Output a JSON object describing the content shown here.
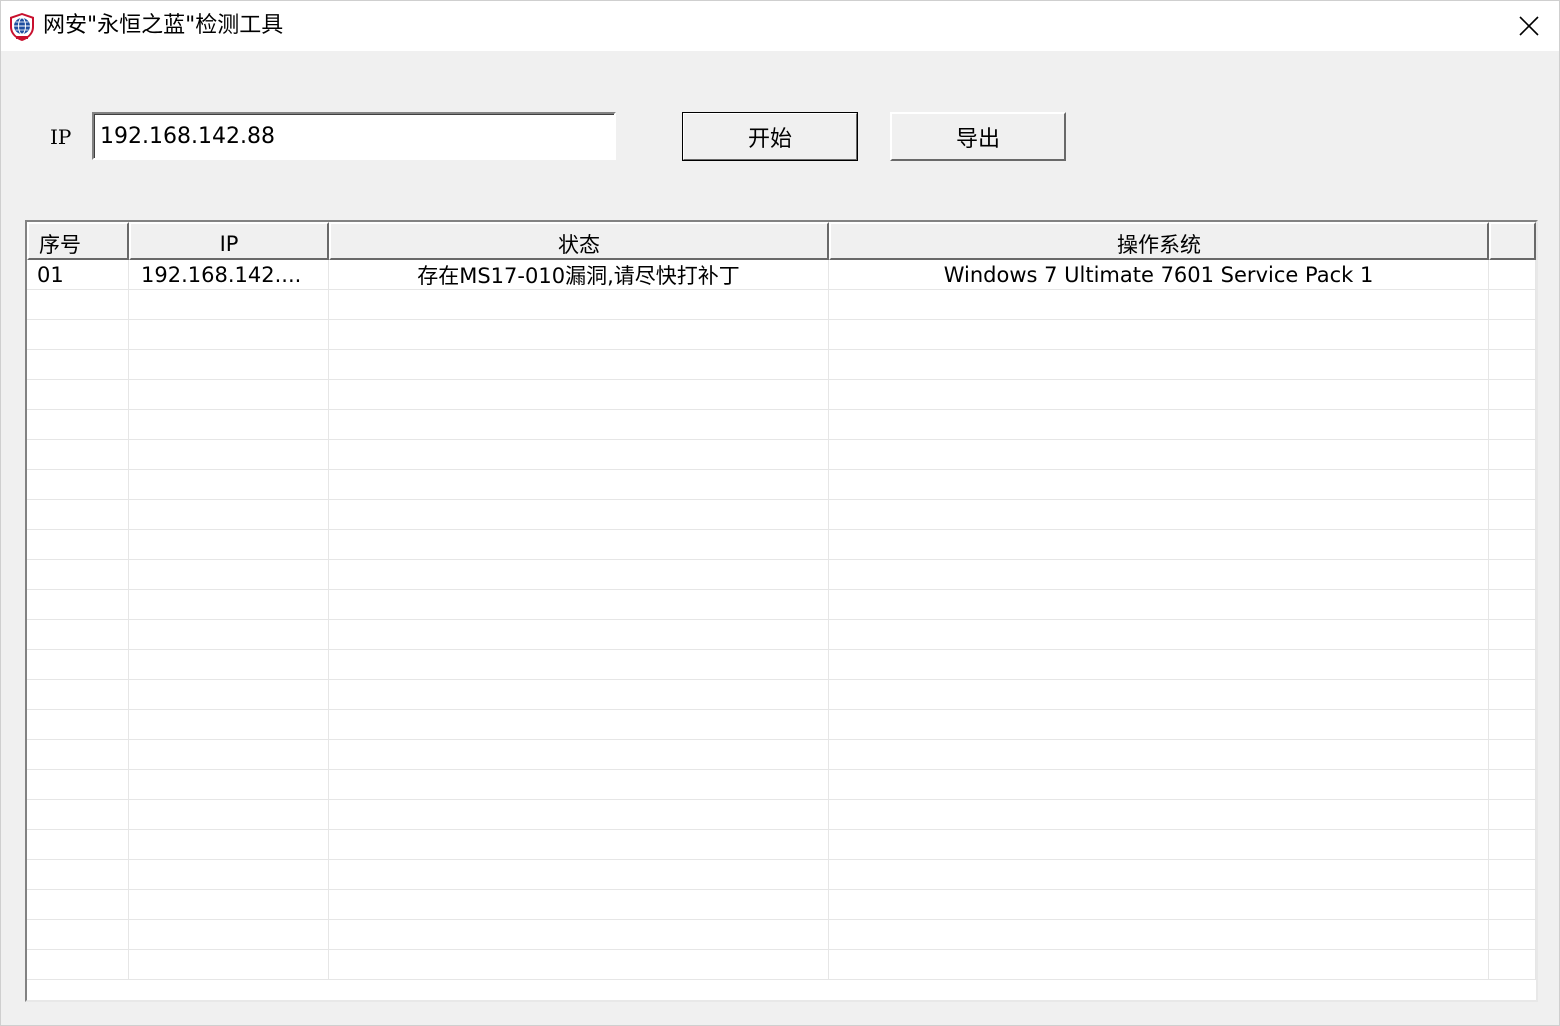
{
  "window": {
    "title": "网安\"永恒之蓝\"检测工具"
  },
  "icons": {
    "app": "shield-globe-icon",
    "close": "close-icon"
  },
  "form": {
    "ip_label": "IP",
    "ip_value": "192.168.142.88",
    "start_label": "开始",
    "export_label": "导出"
  },
  "table": {
    "columns": [
      "序号",
      "IP",
      "状态",
      "操作系统",
      ""
    ],
    "rows": [
      {
        "index": "01",
        "ip": "192.168.142....",
        "status": "存在MS17-010漏洞,请尽快打补丁",
        "os": "Windows 7 Ultimate 7601 Service Pack 1",
        "extra": ""
      }
    ]
  },
  "colors": {
    "background": "#f0f0f0",
    "titlebar": "#ffffff",
    "grid_line": "#e6e6e6",
    "icon_blue": "#1f4fa0",
    "icon_red": "#c8102e"
  }
}
